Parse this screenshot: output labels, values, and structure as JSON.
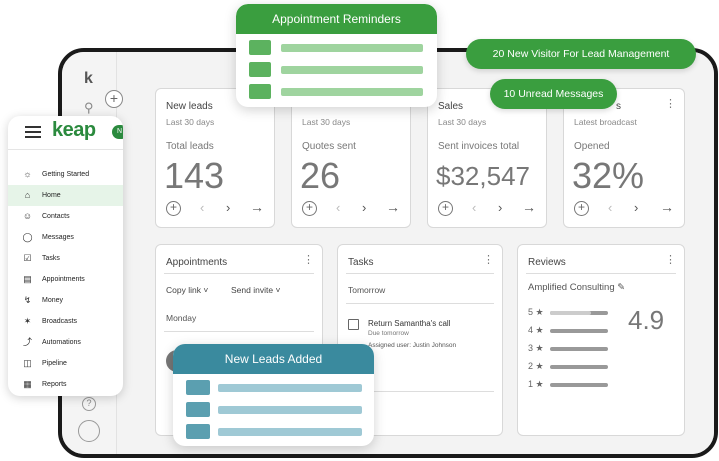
{
  "overlays": {
    "reminders_title": "Appointment Reminders",
    "visitor_pill": "20 New Visitor For Lead Management",
    "unread_pill": "10 Unread Messages",
    "new_leads_title": "New Leads Added"
  },
  "nav": {
    "brand": "keap",
    "brand_badge": "N",
    "items": [
      {
        "label": "Getting Started",
        "icon": "sun-icon"
      },
      {
        "label": "Home",
        "icon": "home-icon"
      },
      {
        "label": "Contacts",
        "icon": "person-icon"
      },
      {
        "label": "Messages",
        "icon": "chat-icon"
      },
      {
        "label": "Tasks",
        "icon": "checklist-icon"
      },
      {
        "label": "Appointments",
        "icon": "calendar-icon"
      },
      {
        "label": "Money",
        "icon": "money-icon"
      },
      {
        "label": "Broadcasts",
        "icon": "broadcast-icon"
      },
      {
        "label": "Automations",
        "icon": "automation-icon"
      },
      {
        "label": "Pipeline",
        "icon": "pipeline-icon"
      },
      {
        "label": "Reports",
        "icon": "report-icon"
      }
    ]
  },
  "cards": {
    "new_leads": {
      "title": "New leads",
      "sub": "Last 30 days",
      "label": "Total leads",
      "value": "143"
    },
    "quotes": {
      "sub": "Last 30 days",
      "label": "Quotes sent",
      "value": "26"
    },
    "sales": {
      "title": "Sales",
      "sub": "Last 30 days",
      "label": "Sent invoices total",
      "value": "$32,547"
    },
    "broadcast": {
      "title": "s",
      "sub": "Latest broadcast",
      "label": "Opened",
      "value": "32%"
    }
  },
  "appointments": {
    "title": "Appointments",
    "copy_link": "Copy link",
    "send_invite": "Send invite",
    "day": "Monday"
  },
  "tasks": {
    "title": "Tasks",
    "day": "Tomorrow",
    "task": "Return Samantha's call",
    "due": "Due tomorrow",
    "assigned": "Assigned user: Justin Johnson"
  },
  "reviews": {
    "title": "Reviews",
    "company": "Amplified Consulting",
    "score": "4.9",
    "rows": [
      {
        "label": "5 ★",
        "fill": 0.7
      },
      {
        "label": "4 ★",
        "fill": 0
      },
      {
        "label": "3 ★",
        "fill": 0
      },
      {
        "label": "2 ★",
        "fill": 0
      },
      {
        "label": "1 ★",
        "fill": 0
      }
    ]
  }
}
